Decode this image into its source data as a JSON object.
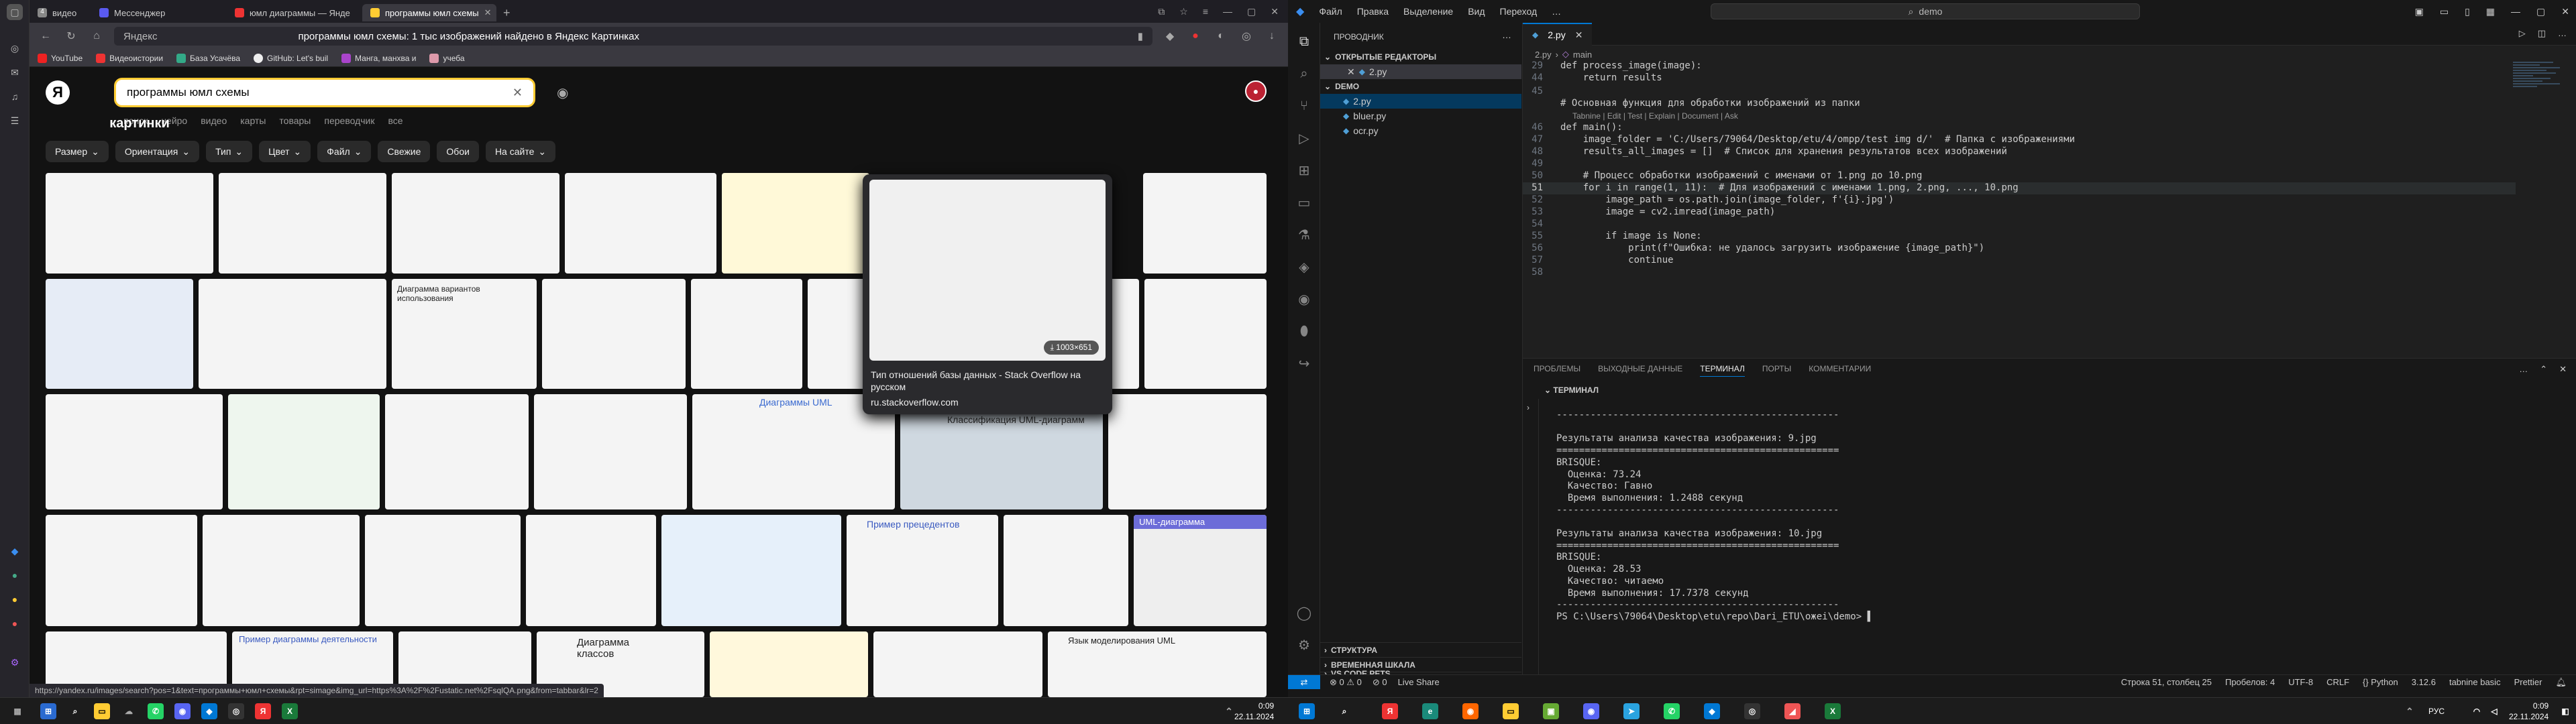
{
  "browser": {
    "tabs": [
      {
        "label": "видео",
        "count": "4",
        "color": "#888"
      },
      {
        "label": "Мессенджер",
        "color": "#5a5af0"
      },
      {
        "label": "юмл диаграммы — Янде",
        "color": "#e33"
      },
      {
        "label": "программы юмл схемы",
        "color": "#fc3",
        "active": true
      }
    ],
    "address": {
      "host": "Яндекс",
      "title": "программы юмл схемы: 1 тыс изображений найдено в Яндекс Картинках"
    },
    "bookmarks": [
      "YouTube",
      "Видеоистории",
      "База Усачёва",
      "GitHub: Let's buil",
      "Манга, манхва и",
      "учеба"
    ],
    "status_url": "https://yandex.ru/images/search?pos=1&text=программы+юмл+схемы&rpt=simage&img_url=https%3A%2F%2Fustatic.net%2FsqlQA.png&from=tabbar&lr=2"
  },
  "yandex": {
    "search_query": "программы юмл схемы",
    "service_tabs": [
      "поиск",
      "нейро",
      "картинки",
      "видео",
      "карты",
      "товары",
      "переводчик",
      "все"
    ],
    "active_tab": "картинки",
    "filters": [
      "Размер",
      "Ориентация",
      "Тип",
      "Цвет",
      "Файл",
      "Свежие",
      "Обои",
      "На сайте"
    ],
    "tooltip": {
      "size": "1003×651",
      "title": "Тип отношений базы данных - Stack Overflow на русском",
      "source": "ru.stackoverflow.com"
    },
    "thumb_labels": [
      "Диаграмма вариантов использования",
      "Диаграммы UML",
      "Классификация UML-диаграмм",
      "Пример прецедентов",
      "UML-диаграмма",
      "Диаграмма классов",
      "Язык моделирования UML",
      "Пример диаграммы деятельности"
    ]
  },
  "vscode": {
    "menu": [
      "Файл",
      "Правка",
      "Выделение",
      "Вид",
      "Переход"
    ],
    "command_center": "demo",
    "explorer_title": "ПРОВОДНИК",
    "open_editors": "ОТКРЫТЫЕ РЕДАКТОРЫ",
    "open_file": "2.py",
    "folder": "DEMO",
    "files": [
      "2.py",
      "bluer.py",
      "ocr.py"
    ],
    "outline": "СТРУКТУРА",
    "timeline": "ВРЕМЕННАЯ ШКАЛА",
    "pets": "VS CODE PETS",
    "tab": "2.py",
    "crumbs": [
      "2.py",
      "main"
    ],
    "codelens": "Tabnine | Edit | Test | Explain | Document | Ask",
    "code": [
      {
        "n": "29",
        "t": "def process_image(image):"
      },
      {
        "n": "44",
        "t": "    return results"
      },
      {
        "n": "45",
        "t": ""
      },
      {
        "n": "",
        "t": "# Основная функция для обработки изображений из папки"
      },
      {
        "n": "46",
        "t": "def main():"
      },
      {
        "n": "47",
        "t": "    image_folder = 'C:/Users/79064/Desktop/etu/4/ompp/test img d/'  # Папка с изображениями"
      },
      {
        "n": "48",
        "t": "    results_all_images = []  # Список для хранения результатов всех изображений"
      },
      {
        "n": "49",
        "t": ""
      },
      {
        "n": "50",
        "t": "    # Процесс обработки изображений с именами от 1.png до 10.png"
      },
      {
        "n": "51",
        "t": "    for i in range(1, 11):  # Для изображений с именами 1.png, 2.png, ..., 10.png"
      },
      {
        "n": "52",
        "t": "        image_path = os.path.join(image_folder, f'{i}.jpg')"
      },
      {
        "n": "53",
        "t": "        image = cv2.imread(image_path)"
      },
      {
        "n": "54",
        "t": ""
      },
      {
        "n": "55",
        "t": "        if image is None:"
      },
      {
        "n": "56",
        "t": "            print(f\"Ошибка: не удалось загрузить изображение {image_path}\")"
      },
      {
        "n": "57",
        "t": "            continue"
      },
      {
        "n": "58",
        "t": ""
      }
    ],
    "panel_tabs": [
      "ПРОБЛЕМЫ",
      "ВЫХОДНЫЕ ДАННЫЕ",
      "ТЕРМИНАЛ",
      "ПОРТЫ",
      "КОММЕНТАРИИ"
    ],
    "panel_active": "ТЕРМИНАЛ",
    "terminal_header": "ТЕРМИНАЛ",
    "terminal": "--------------------------------------------------\n\nРезультаты анализа качества изображения: 9.jpg\n==================================================\nBRISQUE:\n  Оценка: 73.24\n  Качество: Гавно\n  Время выполнения: 1.2488 секунд\n--------------------------------------------------\n\nРезультаты анализа качества изображения: 10.jpg\n==================================================\nBRISQUE:\n  Оценка: 28.53\n  Качество: читаемо\n  Время выполнения: 17.7378 секунд\n--------------------------------------------------\nPS C:\\Users\\79064\\Desktop\\etu\\repo\\Dari_ETU\\oжei\\demo> ▌",
    "status_left": [
      "⊗ 0  ⚠ 0",
      "⊘ 0",
      "Live Share"
    ],
    "status_right": [
      "Строка 51, столбец 25",
      "Пробелов: 4",
      "UTF-8",
      "CRLF",
      "{} Python",
      "3.12.6",
      "tabnine basic",
      "Prettier"
    ]
  },
  "taskbar": {
    "lang": "РУС",
    "time": "0:09",
    "date": "22.11.2024"
  }
}
